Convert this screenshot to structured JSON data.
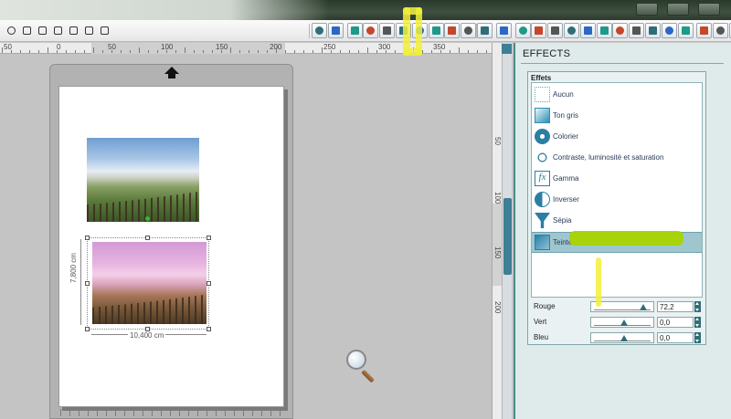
{
  "colors": {
    "accent": "#3d7f95",
    "panel_bg": "#dfeaeb",
    "selected_item": "#9fc6cf",
    "highlight_yellow": "#f3f03a",
    "highlight_green": "#a8d400"
  },
  "toolbar": {
    "left_tools": [
      "redo-icon",
      "hand-icon",
      "zoom-in-icon",
      "zoom-out-icon",
      "zoom-area-icon",
      "hand-pointer-icon",
      "fit-page-icon"
    ],
    "right_tools": [
      "stamp-icon",
      "window-icon",
      "frame-icon",
      "pentagon-icon",
      "hexagon-icon",
      "star-icon",
      "polygon-icon",
      "octagon-icon",
      "lines-icon",
      "equals-icon",
      "text-icon",
      "move-icon",
      "rotate-icon",
      "resize-icon",
      "crop-icon",
      "flip-icon",
      "align-icon",
      "layers-icon",
      "page-icon",
      "effects-icon",
      "grid-icon",
      "phone-icon",
      "tablet-icon",
      "grid2-icon",
      "eraser-icon",
      "options-icon"
    ]
  },
  "ruler": {
    "h_labels": [
      "50",
      "0",
      "50",
      "100",
      "150",
      "200",
      "250",
      "300",
      "350"
    ],
    "v_labels": [
      "50",
      "100",
      "150",
      "200"
    ]
  },
  "photo": {
    "height_label": "7,800 cm",
    "width_label": "10,400 cm"
  },
  "panel": {
    "title": "EFFECTS",
    "group_label": "Effets",
    "effects": [
      {
        "label": "Aucun",
        "icon": "none-icon"
      },
      {
        "label": "Ton gris",
        "icon": "grayscale-icon"
      },
      {
        "label": "Colorier",
        "icon": "palette-icon"
      },
      {
        "label": "Contraste, luminosité et saturation",
        "icon": "sun-icon"
      },
      {
        "label": "Gamma",
        "icon": "fx-icon"
      },
      {
        "label": "Inverser",
        "icon": "invert-icon"
      },
      {
        "label": "Sépia",
        "icon": "funnel-icon"
      },
      {
        "label": "Teinte",
        "icon": "tint-icon"
      }
    ],
    "selected_effect": "Teinte",
    "controls": [
      {
        "label": "Rouge",
        "value": "72,2",
        "level": 0.85
      },
      {
        "label": "Vert",
        "value": "0,0",
        "level": 0.5
      },
      {
        "label": "Bleu",
        "value": "0,0",
        "level": 0.5
      }
    ]
  }
}
